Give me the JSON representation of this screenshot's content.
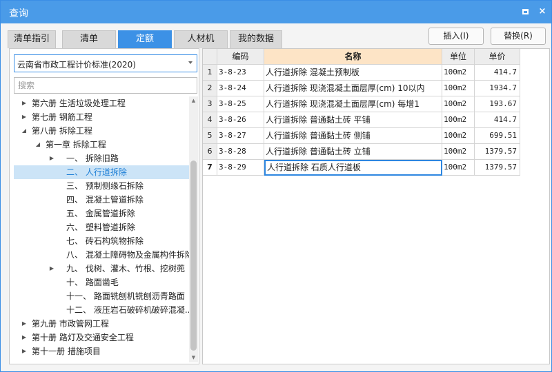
{
  "window": {
    "title": "查询",
    "maximize_glyph": "max-icon",
    "close_glyph": "×"
  },
  "tabs": [
    {
      "label": "清单指引",
      "active": false
    },
    {
      "label": "清单",
      "active": false
    },
    {
      "label": "定额",
      "active": true
    },
    {
      "label": "人材机",
      "active": false
    },
    {
      "label": "我的数据",
      "active": false
    }
  ],
  "actions": {
    "insert_label": "插入(I)",
    "replace_label": "替换(R)"
  },
  "left": {
    "standard_select": "云南省市政工程计价标准(2020)",
    "search_placeholder": "搜索"
  },
  "tree": [
    {
      "label": "第六册 生活垃圾处理工程",
      "indent": 0,
      "arrow": "right",
      "selected": false
    },
    {
      "label": "第七册 钢筋工程",
      "indent": 0,
      "arrow": "right",
      "selected": false
    },
    {
      "label": "第八册 拆除工程",
      "indent": 0,
      "arrow": "down",
      "selected": false
    },
    {
      "label": "第一章 拆除工程",
      "indent": 1,
      "arrow": "down",
      "selected": false
    },
    {
      "label": "一、 拆除旧路",
      "indent": 2,
      "arrow": "right",
      "selected": false
    },
    {
      "label": "二、 人行道拆除",
      "indent": 2,
      "arrow": "none",
      "selected": true
    },
    {
      "label": "三、 预制侧缘石拆除",
      "indent": 2,
      "arrow": "none",
      "selected": false
    },
    {
      "label": "四、 混凝土管道拆除",
      "indent": 2,
      "arrow": "none",
      "selected": false
    },
    {
      "label": "五、 金属管道拆除",
      "indent": 2,
      "arrow": "none",
      "selected": false
    },
    {
      "label": "六、 塑料管道拆除",
      "indent": 2,
      "arrow": "none",
      "selected": false
    },
    {
      "label": "七、 砖石构筑物拆除",
      "indent": 2,
      "arrow": "none",
      "selected": false
    },
    {
      "label": "八、 混凝土障碍物及金属构件拆除",
      "indent": 2,
      "arrow": "none",
      "selected": false
    },
    {
      "label": "九、 伐树、灌木、竹根、挖树蔸",
      "indent": 2,
      "arrow": "right",
      "selected": false
    },
    {
      "label": "十、 路面凿毛",
      "indent": 2,
      "arrow": "none",
      "selected": false
    },
    {
      "label": "十一、 路面铣刨机铣刨沥青路面",
      "indent": 2,
      "arrow": "none",
      "selected": false
    },
    {
      "label": "十二、 液压岩石破碎机破碎混凝...",
      "indent": 2,
      "arrow": "none",
      "selected": false
    },
    {
      "label": "第九册 市政管网工程",
      "indent": 0,
      "arrow": "right",
      "selected": false
    },
    {
      "label": "第十册 路灯及交通安全工程",
      "indent": 0,
      "arrow": "right",
      "selected": false
    },
    {
      "label": "第十一册 措施项目",
      "indent": 0,
      "arrow": "right",
      "selected": false
    }
  ],
  "table": {
    "columns": [
      "",
      "编码",
      "名称",
      "单位",
      "单价"
    ],
    "active_column": 2,
    "selected_row": 6,
    "rows": [
      {
        "idx": "1",
        "code": "3-8-23",
        "name": "人行道拆除 混凝土预制板",
        "unit": "100m2",
        "price": "414.7"
      },
      {
        "idx": "2",
        "code": "3-8-24",
        "name": "人行道拆除 现浇混凝土面层厚(cm) 10以内",
        "unit": "100m2",
        "price": "1934.7"
      },
      {
        "idx": "3",
        "code": "3-8-25",
        "name": "人行道拆除 现浇混凝土面层厚(cm) 每增1",
        "unit": "100m2",
        "price": "193.67"
      },
      {
        "idx": "4",
        "code": "3-8-26",
        "name": "人行道拆除 普通黏土砖 平铺",
        "unit": "100m2",
        "price": "414.7"
      },
      {
        "idx": "5",
        "code": "3-8-27",
        "name": "人行道拆除 普通黏土砖 侧铺",
        "unit": "100m2",
        "price": "699.51"
      },
      {
        "idx": "6",
        "code": "3-8-28",
        "name": "人行道拆除 普通黏土砖 立铺",
        "unit": "100m2",
        "price": "1379.57"
      },
      {
        "idx": "7",
        "code": "3-8-29",
        "name": "人行道拆除 石质人行道板",
        "unit": "100m2",
        "price": "1379.57"
      }
    ]
  },
  "colors": {
    "titlebar": "#4a9be8",
    "tab_active": "#3c91e6",
    "selection": "#cce4f7",
    "header_active": "#fde4c6"
  }
}
